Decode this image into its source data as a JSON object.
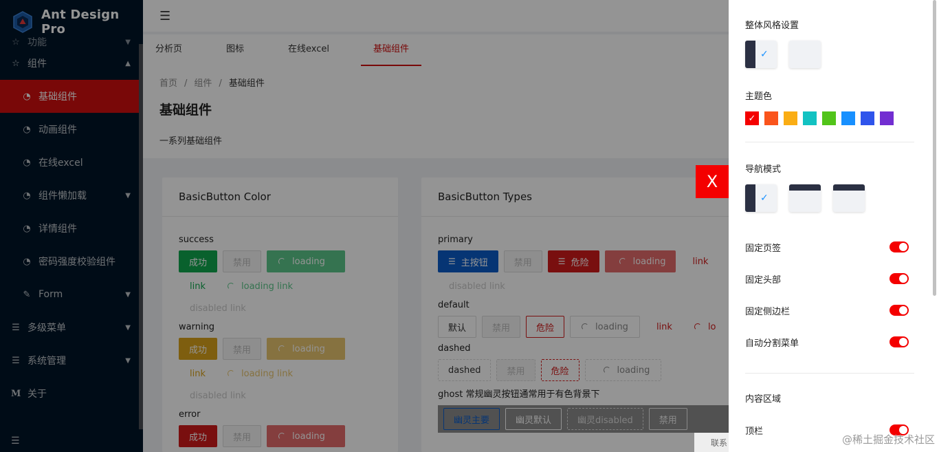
{
  "app": {
    "title": "Ant Design Pro"
  },
  "sidebar": {
    "partial_item": "功能",
    "items": [
      {
        "label": "组件",
        "icon": "star-icon",
        "arrow": "▲"
      },
      {
        "label": "基础组件",
        "icon": "dashboard-icon",
        "active": true
      },
      {
        "label": "动画组件",
        "icon": "dashboard-icon"
      },
      {
        "label": "在线excel",
        "icon": "dashboard-icon"
      },
      {
        "label": "组件懒加载",
        "icon": "dashboard-icon",
        "arrow": "▼"
      },
      {
        "label": "详情组件",
        "icon": "dashboard-icon"
      },
      {
        "label": "密码强度校验组件",
        "icon": "dashboard-icon"
      },
      {
        "label": "Form",
        "icon": "form-icon",
        "arrow": "▼"
      },
      {
        "label": "多级菜单",
        "icon": "menu-icon",
        "arrow": "▼"
      },
      {
        "label": "系统管理",
        "icon": "menu-icon",
        "arrow": "▼"
      },
      {
        "label": "关于",
        "icon": "m-icon"
      }
    ]
  },
  "tabs": [
    "分析页",
    "图标",
    "在线excel",
    "基础组件"
  ],
  "breadcrumb": {
    "home": "首页",
    "parent": "组件",
    "current": "基础组件",
    "separator": "/"
  },
  "page": {
    "title": "基础组件",
    "desc": "一系列基础组件"
  },
  "card_color": {
    "title": "BasicButton Color",
    "groups": [
      {
        "label": "success",
        "color": "#11a84f",
        "btn_ok": "成功",
        "btn_disabled": "禁用",
        "btn_loading": "loading",
        "link": "link",
        "loading_link": "loading link",
        "disabled_link": "disabled link"
      },
      {
        "label": "warning",
        "color": "#d9a21b",
        "btn_ok": "成功",
        "btn_disabled": "禁用",
        "btn_loading": "loading",
        "link": "link",
        "loading_link": "loading link",
        "disabled_link": "disabled link"
      },
      {
        "label": "error",
        "color": "#d01b1b",
        "btn_ok": "成功",
        "btn_disabled": "禁用",
        "btn_loading": "loading"
      }
    ]
  },
  "card_types": {
    "title": "BasicButton Types",
    "primary": {
      "label": "primary",
      "main": "主按钮",
      "disabled": "禁用",
      "danger": "危险",
      "loading": "loading",
      "link": "link",
      "disabled_link": "disabled link"
    },
    "default": {
      "label": "default",
      "default": "默认",
      "disabled": "禁用",
      "danger": "危险",
      "loading": "loading",
      "link": "link",
      "loading_link_partial": "lo"
    },
    "dashed": {
      "label": "dashed",
      "dashed": "dashed",
      "disabled": "禁用",
      "danger": "危险",
      "loading": "loading"
    },
    "ghost": {
      "label": "ghost 常规幽灵按钮通常用于有色背景下",
      "main": "幽灵主要",
      "default": "幽灵默认",
      "disabled": "幽灵disabled",
      "forbid": "禁用"
    }
  },
  "drawer": {
    "overall_style": "整体风格设置",
    "theme_color": "主题色",
    "theme_colors": [
      "#f40000",
      "#fa541c",
      "#faad14",
      "#13c2c2",
      "#52c41a",
      "#1890ff",
      "#2f54eb",
      "#722ed1"
    ],
    "nav_mode": "导航模式",
    "settings": [
      "固定页签",
      "固定头部",
      "固定侧边栏",
      "自动分割菜单"
    ],
    "content_area": "内容区域",
    "content_settings": [
      "顶栏"
    ],
    "accent": "#f40000"
  },
  "close_label": "X",
  "contact_partial": "联系",
  "watermark": "@稀土掘金技术社区"
}
